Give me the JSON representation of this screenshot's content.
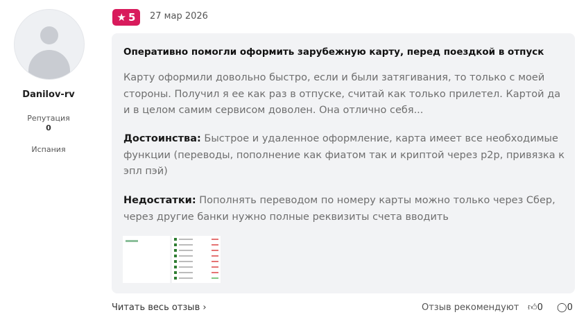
{
  "user": {
    "name": "Danilov-rv",
    "reputation_label": "Репутация",
    "reputation_value": "0",
    "country": "Испания"
  },
  "review": {
    "rating": "5",
    "date": "27 мар 2026",
    "title": "Оперативно помогли оформить зарубежную карту, перед поездкой в отпуск",
    "text": "Карту оформили довольно быстро, если и были затягивания, то только с моей стороны. Получил я ее как раз в отпуске, считай как только прилетел. Картой да и в целом самим сервисом доволен. Она отлично себя...",
    "pros_label": "Достоинства:",
    "pros": "Быстрое и удаленное оформление, карта имеет все необходимые функции (переводы, пополнение как фиатом так и криптой через р2р, привязка к эпл пэй)",
    "cons_label": "Недостатки:",
    "cons": "Пополнять переводом по номеру карты можно только через Сбер, через другие банки нужно полные реквизиты счета вводить"
  },
  "footer": {
    "read_more": "Читать весь отзыв",
    "recommend_label": "Отзыв рекомендуют",
    "likes": "0",
    "comments": "0"
  },
  "colors": {
    "accent": "#d81b5c",
    "card": "#f2f3f5"
  }
}
